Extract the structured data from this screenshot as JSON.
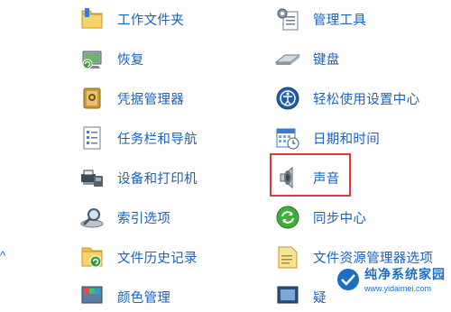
{
  "left_fragment": "^",
  "left_column": [
    {
      "label": "工作文件夹",
      "icon": "work-folder-icon"
    },
    {
      "label": "恢复",
      "icon": "recovery-icon"
    },
    {
      "label": "凭据管理器",
      "icon": "credential-manager-icon"
    },
    {
      "label": "任务栏和导航",
      "icon": "taskbar-icon"
    },
    {
      "label": "设备和打印机",
      "icon": "printer-icon"
    },
    {
      "label": "索引选项",
      "icon": "indexing-icon"
    },
    {
      "label": "文件历史记录",
      "icon": "file-history-icon"
    },
    {
      "label": "颜色管理",
      "icon": "color-management-icon"
    }
  ],
  "right_column": [
    {
      "label": "管理工具",
      "icon": "admin-tools-icon"
    },
    {
      "label": "键盘",
      "icon": "keyboard-icon"
    },
    {
      "label": "轻松使用设置中心",
      "icon": "ease-of-access-icon"
    },
    {
      "label": "日期和时间",
      "icon": "calendar-clock-icon"
    },
    {
      "label": "声音",
      "icon": "speaker-icon",
      "highlighted": true
    },
    {
      "label": "同步中心",
      "icon": "sync-icon"
    },
    {
      "label": "文件资源管理器选项",
      "icon": "folder-options-icon"
    },
    {
      "label": "疑",
      "icon": "troubleshoot-icon"
    }
  ],
  "highlight_color": "#e03838",
  "link_color": "#1a62b8",
  "watermark": {
    "title": "纯净系统家园",
    "url": "www.yidaimei.com"
  }
}
